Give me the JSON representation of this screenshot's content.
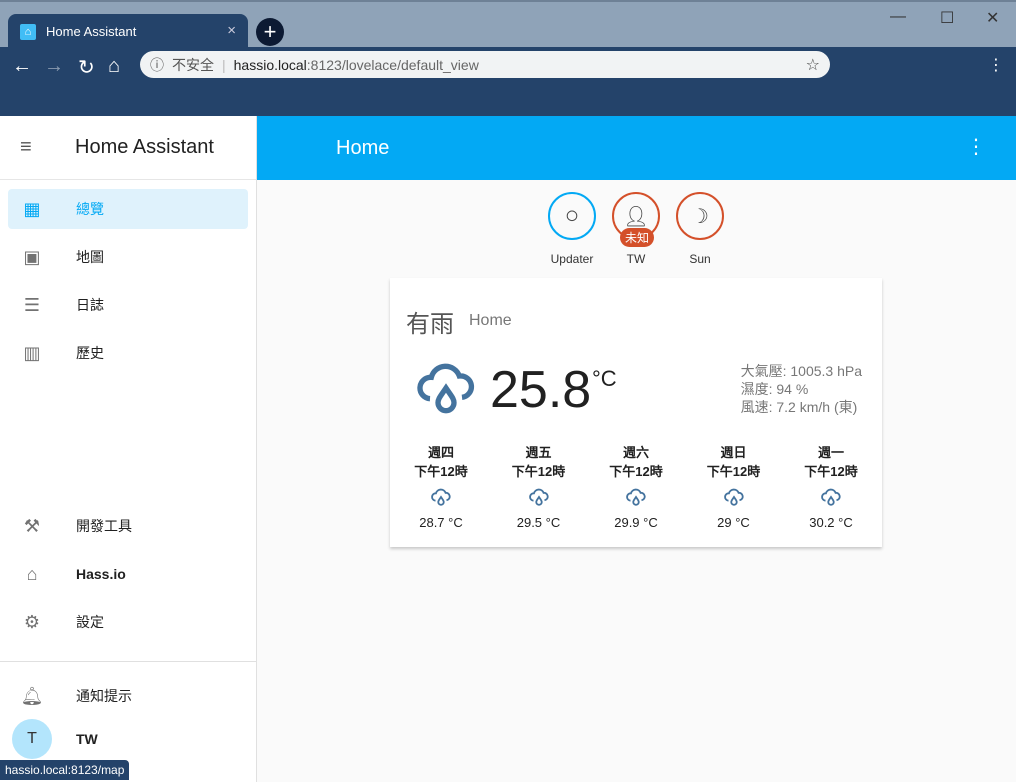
{
  "browser": {
    "tab_title": "Home Assistant",
    "insecure_label": "不安全",
    "url_host": "hassio.local",
    "url_path": ":8123/lovelace/default_view",
    "status_url": "hassio.local:8123/map"
  },
  "sidebar": {
    "title": "Home Assistant",
    "items": [
      {
        "label": "總覽",
        "icon": "view-grid-icon"
      },
      {
        "label": "地圖",
        "icon": "account-location-icon"
      },
      {
        "label": "日誌",
        "icon": "format-list-icon"
      },
      {
        "label": "歷史",
        "icon": "chart-bar-icon"
      },
      {
        "label": "開發工具",
        "icon": "hammer-icon"
      },
      {
        "label": "Hass.io",
        "icon": "home-assistant-icon"
      },
      {
        "label": "設定",
        "icon": "gear-icon"
      },
      {
        "label": "通知提示",
        "icon": "bell-icon"
      }
    ],
    "user": {
      "initial": "T",
      "name": "TW"
    }
  },
  "header": {
    "title": "Home"
  },
  "badges": [
    {
      "label": "Updater"
    },
    {
      "label": "TW",
      "pill": "未知"
    },
    {
      "label": "Sun"
    }
  ],
  "weather": {
    "condition": "有雨",
    "location": "Home",
    "temperature": "25.8",
    "unit": "°C",
    "pressure": "大氣壓: 1005.3 hPa",
    "humidity": "濕度: 94 %",
    "wind": "風速: 7.2 km/h (東)",
    "forecast": [
      {
        "day": "週四",
        "time": "下午12時",
        "temp": "28.7 °C"
      },
      {
        "day": "週五",
        "time": "下午12時",
        "temp": "29.5 °C"
      },
      {
        "day": "週六",
        "time": "下午12時",
        "temp": "29.9 °C"
      },
      {
        "day": "週日",
        "time": "下午12時",
        "temp": "29 °C"
      },
      {
        "day": "週一",
        "time": "下午12時",
        "temp": "30.2 °C"
      }
    ]
  },
  "colors": {
    "primary": "#03a9f4",
    "browser": "#24436a",
    "badge_alert": "#d4502a",
    "weather_icon": "#44739e"
  }
}
